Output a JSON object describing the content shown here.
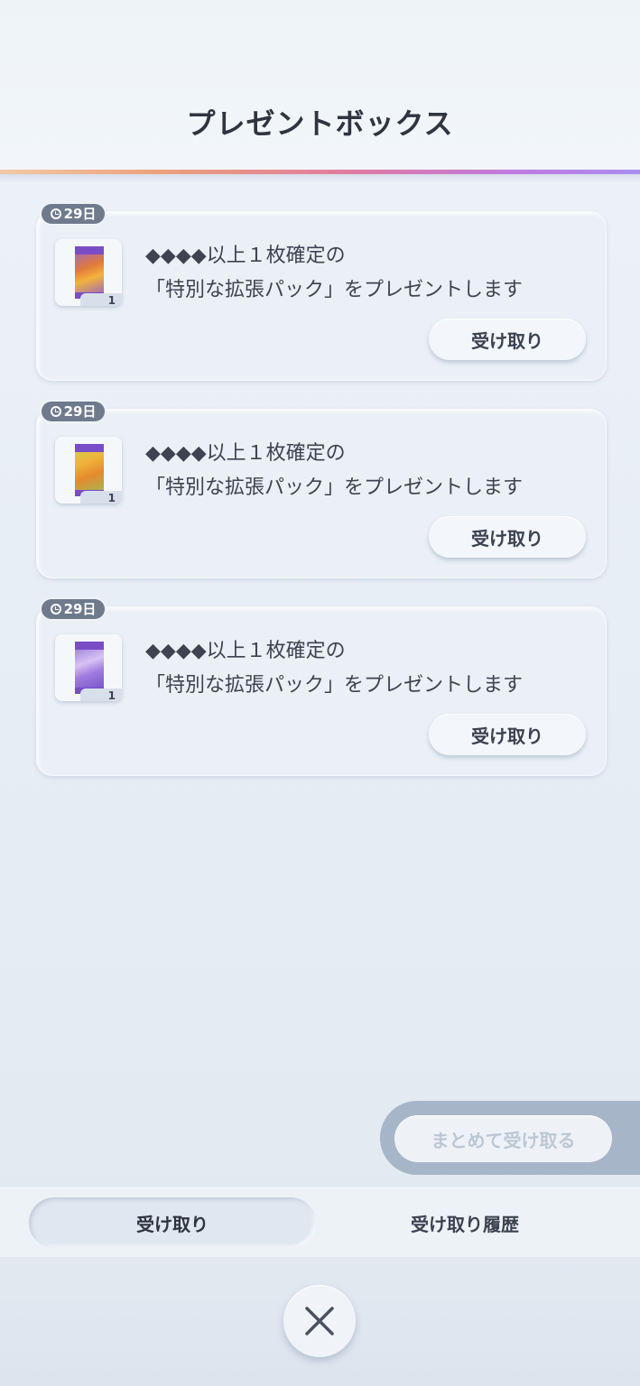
{
  "header": {
    "title": "プレゼントボックス"
  },
  "presents": [
    {
      "expiry": "29日",
      "line1": "◆◆◆◆以上１枚確定の",
      "line2": "「特別な拡張パック」をプレゼントします",
      "quantity": "1",
      "receive_label": "受け取り",
      "icon": "booster-pack-icon"
    },
    {
      "expiry": "29日",
      "line1": "◆◆◆◆以上１枚確定の",
      "line2": "「特別な拡張パック」をプレゼントします",
      "quantity": "1",
      "receive_label": "受け取り",
      "icon": "booster-pack-icon"
    },
    {
      "expiry": "29日",
      "line1": "◆◆◆◆以上１枚確定の",
      "line2": "「特別な拡張パック」をプレゼントします",
      "quantity": "1",
      "receive_label": "受け取り",
      "icon": "booster-pack-icon"
    }
  ],
  "bulk": {
    "label": "まとめて受け取る",
    "enabled": false
  },
  "tabs": [
    {
      "label": "受け取り",
      "active": true
    },
    {
      "label": "受け取り履歴",
      "active": false
    }
  ],
  "close": {
    "icon": "close-icon"
  },
  "colors": {
    "accent_gradient": [
      "#f2c9a6",
      "#e07aa0",
      "#a98ef0"
    ],
    "badge": "#6f7a8d"
  }
}
